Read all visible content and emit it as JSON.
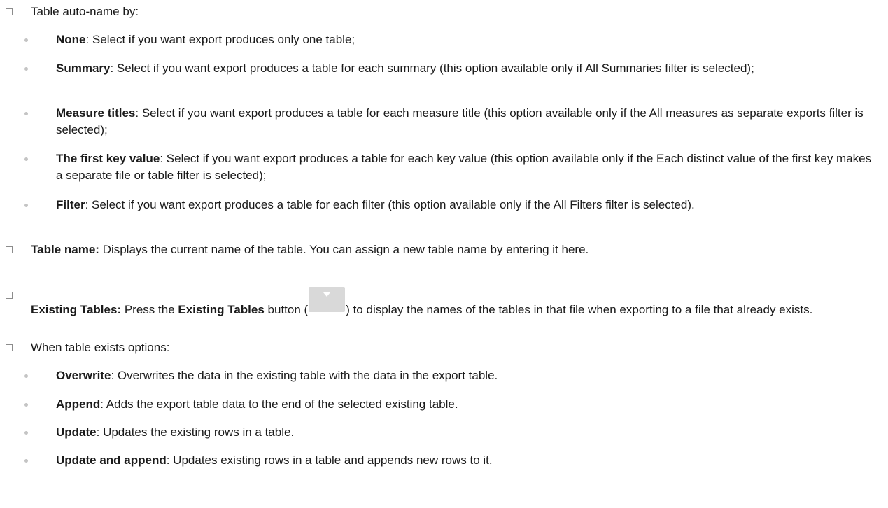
{
  "auto_name": {
    "intro": "Table auto-name by:",
    "items": [
      {
        "term": "None",
        "text": ": Select if you want export produces only one table;"
      },
      {
        "term": "Summary",
        "text": ": Select if you want export produces a table for each summary (this option available only if All Summaries filter is selected);"
      },
      {
        "term": "Measure titles",
        "text": ": Select if you want export produces a table for each measure title (this option available only if the All measures as separate exports filter is selected);"
      },
      {
        "term": "The first key value",
        "text": ": Select if you want export produces a table for each key value (this option available only if the Each distinct value of the first key makes a separate file or table filter is selected);"
      },
      {
        "term": "Filter",
        "text": ": Select if you want export produces a table for each filter (this option available only if the All Filters filter is selected)."
      }
    ]
  },
  "table_name": {
    "term": "Table name:",
    "text": " Displays the current name of the table. You can assign a new table name by entering it here."
  },
  "existing_tables": {
    "term": "Existing Tables:",
    "text_a": " Press the ",
    "button_term": "Existing Tables",
    "text_b": " button (",
    "text_c": ") to display the names of the tables in that file when exporting to a file that already exists.",
    "button_icon": "chevron-down-icon"
  },
  "when_exists": {
    "intro": "When table exists options:",
    "items": [
      {
        "term": "Overwrite",
        "text": ": Overwrites the data in the existing table with the data in the export table."
      },
      {
        "term": "Append",
        "text": ": Adds the export table data to the end of the selected existing table."
      },
      {
        "term": "Update",
        "text": ": Updates the existing rows in a table."
      },
      {
        "term": "Update and append",
        "text": ": Updates existing rows in a table and appends new rows to it."
      }
    ]
  }
}
